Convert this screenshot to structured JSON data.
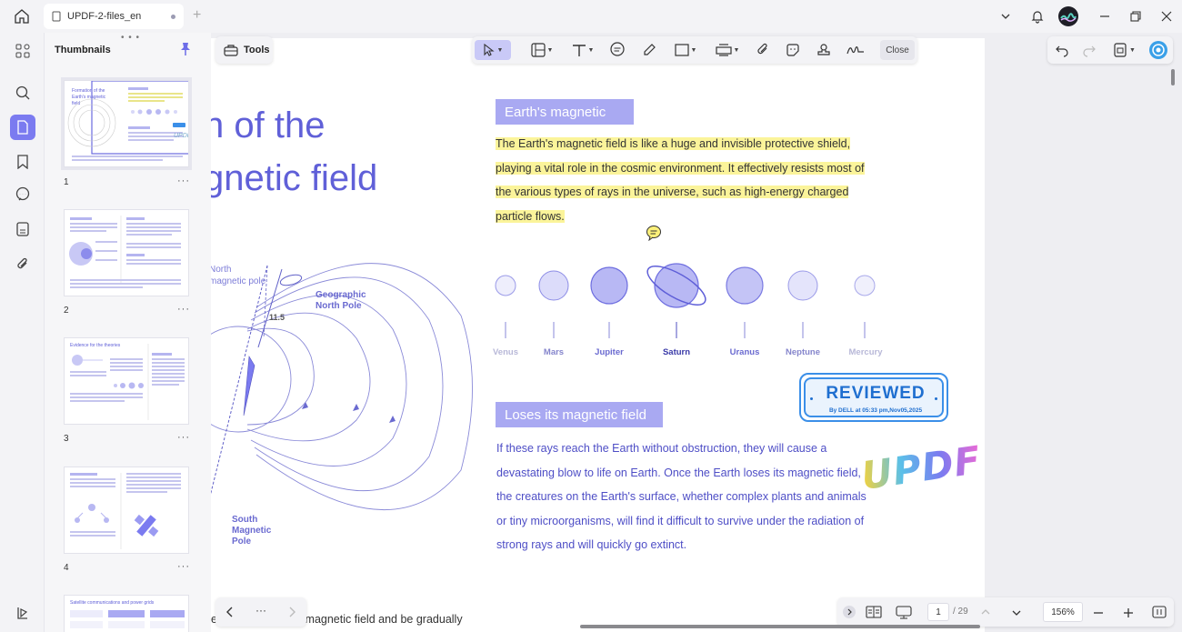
{
  "tab": {
    "title": "UPDF-2-files_en"
  },
  "toolbar": {
    "tools_label": "Tools",
    "close_label": "Close"
  },
  "thumbnails": {
    "title": "Thumbnails",
    "pages": [
      {
        "num": "1",
        "more": "···",
        "heading": "Formation of the Earth's magnetic field"
      },
      {
        "num": "2",
        "more": "···",
        "heading": ""
      },
      {
        "num": "3",
        "more": "···",
        "heading": "Evidence for the theories"
      },
      {
        "num": "4",
        "more": "···",
        "heading": ""
      },
      {
        "num": "",
        "more": "",
        "heading": "Satellite communications and power grids"
      }
    ]
  },
  "page": {
    "title_line1": "n of the",
    "title_line2": "gnetic field",
    "north_label_1": "North",
    "north_label_2": "magnetic pole",
    "angle_label": "11.5",
    "geo_north_1": "Geographic",
    "geo_north_2": "North Pole",
    "south_1": "South",
    "south_2": "Magnetic",
    "south_3": "Pole",
    "section1_title": "Earth's magnetic",
    "section1_lines": [
      "The Earth's magnetic field is like a huge and invisible protective shield,",
      "playing a vital role in the cosmic environment. It effectively resists most of",
      "the various types of rays in the universe, such as high-energy charged",
      "particle flows."
    ],
    "planets": [
      "Venus",
      "Mars",
      "Jupiter",
      "Saturn",
      "Uranus",
      "Neptune",
      "Mercury"
    ],
    "section2_title": "Loses its magnetic field",
    "section2_lines": [
      "If these rays reach the Earth without obstruction, they will cause a",
      "devastating blow to life on Earth. Once the Earth loses its magnetic field,",
      "the creatures on the Earth's surface, whether complex plants and animals",
      "or tiny microorganisms, will find it difficult to survive under the radiation of",
      "strong rays and will quickly go extinct."
    ],
    "bottom_text": "e protection of the magnetic field and be gradually",
    "stamp_title": "REVIEWED",
    "stamp_sub": "By DELL at 05:33 pm,Nov05,2025",
    "sticker_text": "UPDF"
  },
  "status": {
    "current_page": "1",
    "total_pages": "/ 29",
    "zoom": "156%",
    "nav_more": "···"
  },
  "colors": {
    "accent": "#7b7bf0",
    "title_purple": "#6060d8",
    "highlight": "#fbf49a",
    "stamp_blue": "#1f6fd0"
  }
}
